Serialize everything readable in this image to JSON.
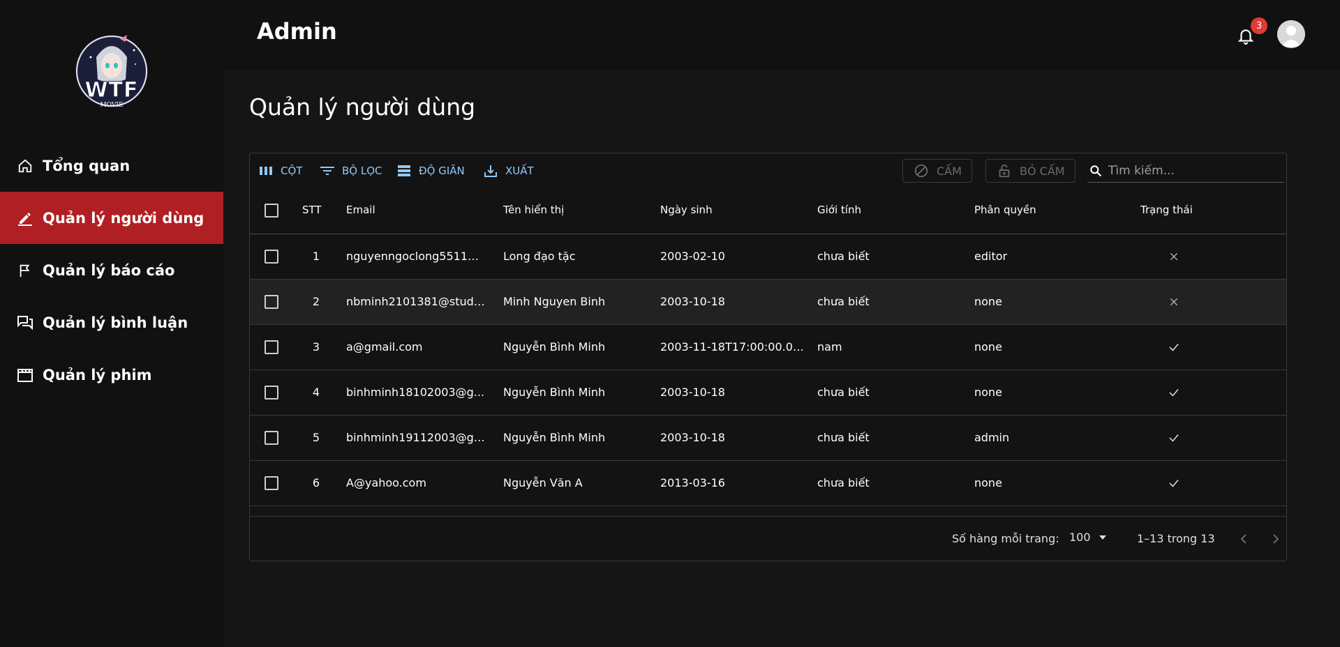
{
  "header": {
    "title": "Admin",
    "notification_count": "3"
  },
  "logo": {
    "text": "WTF",
    "subtext": "MOVIE"
  },
  "sidebar": {
    "items": [
      {
        "label": "Tổng quan",
        "icon": "home-icon",
        "active": false
      },
      {
        "label": "Quản lý người dùng",
        "icon": "edit-icon",
        "active": true
      },
      {
        "label": "Quản lý báo cáo",
        "icon": "flag-icon",
        "active": false
      },
      {
        "label": "Quản lý bình luận",
        "icon": "comments-icon",
        "active": false
      },
      {
        "label": "Quản lý phim",
        "icon": "clapperboard-icon",
        "active": false
      }
    ]
  },
  "page": {
    "title": "Quản lý người dùng"
  },
  "toolbar": {
    "columns_label": "CỘT",
    "filter_label": "BỘ LỌC",
    "density_label": "ĐỘ GIÃN",
    "export_label": "XUẤT",
    "ban_label": "CẤM",
    "unban_label": "BỎ CẤM",
    "search_placeholder": "Tìm kiếm..."
  },
  "table": {
    "columns": [
      "STT",
      "Email",
      "Tên hiển thị",
      "Ngày sinh",
      "Giới tính",
      "Phân quyền",
      "Trạng thái"
    ],
    "rows": [
      {
        "stt": "1",
        "email": "nguyenngoclong5511@...",
        "name": "Long đạo tặc",
        "dob": "2003-02-10",
        "gender": "chưa biết",
        "role": "editor",
        "status": "x-icon"
      },
      {
        "stt": "2",
        "email": "nbminh2101381@studen...",
        "name": "Minh Nguyen Binh",
        "dob": "2003-10-18",
        "gender": "chưa biết",
        "role": "none",
        "status": "x-icon"
      },
      {
        "stt": "3",
        "email": "a@gmail.com",
        "name": "Nguyễn Bình Minh",
        "dob": "2003-11-18T17:00:00.000Z",
        "gender": "nam",
        "role": "none",
        "status": "check-icon"
      },
      {
        "stt": "4",
        "email": "binhminh18102003@g...",
        "name": "Nguyễn Bình Minh",
        "dob": "2003-10-18",
        "gender": "chưa biết",
        "role": "none",
        "status": "check-icon"
      },
      {
        "stt": "5",
        "email": "binhminh19112003@gm...",
        "name": "Nguyễn Bình Minh",
        "dob": "2003-10-18",
        "gender": "chưa biết",
        "role": "admin",
        "status": "check-icon"
      },
      {
        "stt": "6",
        "email": "A@yahoo.com",
        "name": "Nguyễn Văn A",
        "dob": "2013-03-16",
        "gender": "chưa biết",
        "role": "none",
        "status": "check-icon"
      }
    ]
  },
  "footer": {
    "rows_per_page_label": "Số hàng mỗi trang:",
    "rows_per_page_value": "100",
    "range_label": "1–13 trong 13"
  },
  "colors": {
    "accent": "#b01f23",
    "link": "#90caf9",
    "badge": "#e53935"
  }
}
